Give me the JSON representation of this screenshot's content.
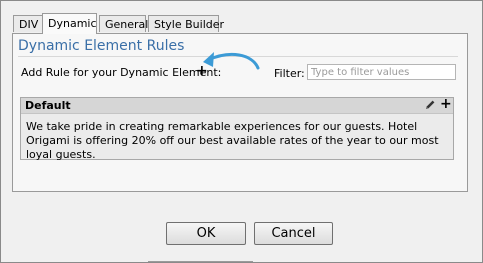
{
  "tabs": [
    {
      "label": "DIV",
      "active": false
    },
    {
      "label": "Dynamic",
      "active": true
    },
    {
      "label": "General",
      "active": false
    },
    {
      "label": "Style Builder",
      "active": false
    }
  ],
  "panel": {
    "title": "Dynamic Element Rules",
    "add_rule_label": "Add Rule for your Dynamic Element:",
    "add_rule_icon": "+",
    "filter_label": "Filter:",
    "filter_placeholder": "Type to filter values",
    "filter_value": ""
  },
  "rule": {
    "name": "Default",
    "add_icon": "+",
    "text": "We take pride in creating remarkable experiences for our guests. Hotel Origami is offering 20% off our best available rates of the year to our most loyal guests."
  },
  "buttons": {
    "ok": "OK",
    "cancel": "Cancel"
  },
  "colors": {
    "title": "#3a6fa7",
    "arrow": "#3c9bd6"
  }
}
